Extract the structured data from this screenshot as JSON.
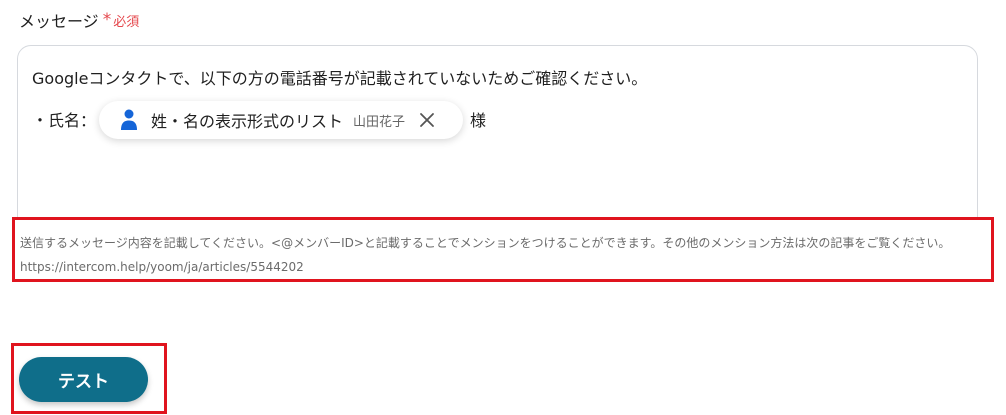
{
  "field": {
    "label": "メッセージ",
    "required_star": "*",
    "required_text": "必須"
  },
  "message": {
    "line1": "Googleコンタクトで、以下の方の電話番号が記載されていないためご確認ください。",
    "line2_prefix": "・氏名：",
    "line2_suffix": "様"
  },
  "chip": {
    "icon": "person-icon",
    "label": "姓・名の表示形式のリスト",
    "sub": "山田花子",
    "close_icon": "close-icon",
    "icon_color": "#1565d8"
  },
  "help": {
    "text": "送信するメッセージ内容を記載してください。<@メンバーID>と記載することでメンションをつけることができます。その他のメンション方法は次の記事をご覧ください。https://intercom.help/yoom/ja/articles/5544202"
  },
  "actions": {
    "test_label": "テスト"
  },
  "colors": {
    "required": "#e5484d",
    "highlight": "#e0141e",
    "button": "#0f6e8a"
  }
}
